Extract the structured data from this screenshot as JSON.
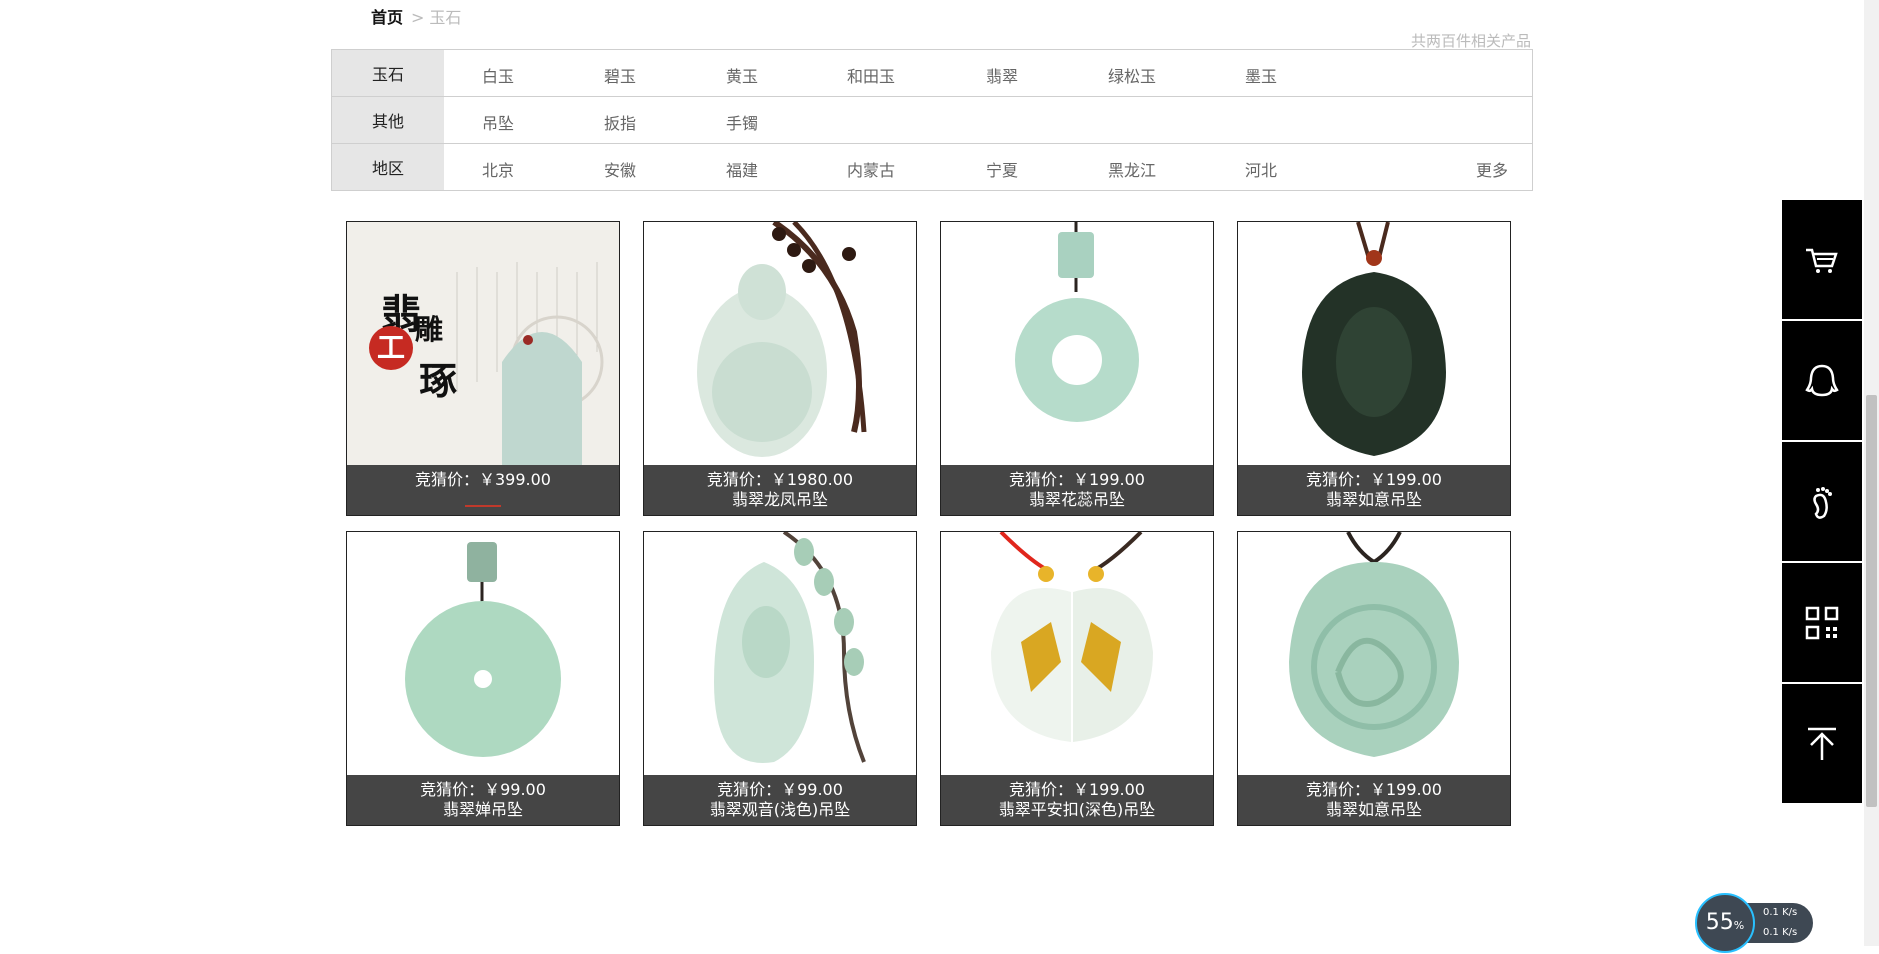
{
  "breadcrumb": {
    "home": "首页",
    "separator": ">",
    "current": "玉石"
  },
  "result_count": "共两百件相关产品",
  "filters": [
    {
      "head": "玉石",
      "items": [
        "白玉",
        "碧玉",
        "黄玉",
        "和田玉",
        "翡翠",
        "绿松玉",
        "墨玉"
      ]
    },
    {
      "head": "其他",
      "items": [
        "吊坠",
        "扳指",
        "手镯"
      ]
    },
    {
      "head": "地区",
      "items": [
        "北京",
        "安徽",
        "福建",
        "内蒙古",
        "宁夏",
        "黑龙江",
        "河北"
      ],
      "more": "更多"
    }
  ],
  "products": [
    {
      "price": "竞猜价：￥399.00",
      "name": ""
    },
    {
      "price": "竞猜价：￥1980.00",
      "name": "翡翠龙凤吊坠"
    },
    {
      "price": "竞猜价：￥199.00",
      "name": "翡翠花蕊吊坠"
    },
    {
      "price": "竞猜价：￥199.00",
      "name": "翡翠如意吊坠"
    },
    {
      "price": "竞猜价：￥99.00",
      "name": "翡翠婵吊坠"
    },
    {
      "price": "竞猜价：￥99.00",
      "name": "翡翠观音(浅色)吊坠"
    },
    {
      "price": "竞猜价：￥199.00",
      "name": "翡翠平安扣(深色)吊坠"
    },
    {
      "price": "竞猜价：￥199.00",
      "name": "翡翠如意吊坠"
    }
  ],
  "product_banner": {
    "line1": "翡",
    "line2": "雕",
    "line3": "琢",
    "seal": "工"
  },
  "sidebar": [
    "cart-icon",
    "qq-icon",
    "footprint-icon",
    "qrcode-icon",
    "back-to-top-icon"
  ],
  "net_widget": {
    "percent": "55",
    "unit": "%",
    "up": "0.1",
    "down": "0.1",
    "rate_unit": "K/s"
  },
  "colors": {
    "jade": "#bfe0cc",
    "caption_bg": "#454545",
    "sidebar_bg": "#000000"
  }
}
